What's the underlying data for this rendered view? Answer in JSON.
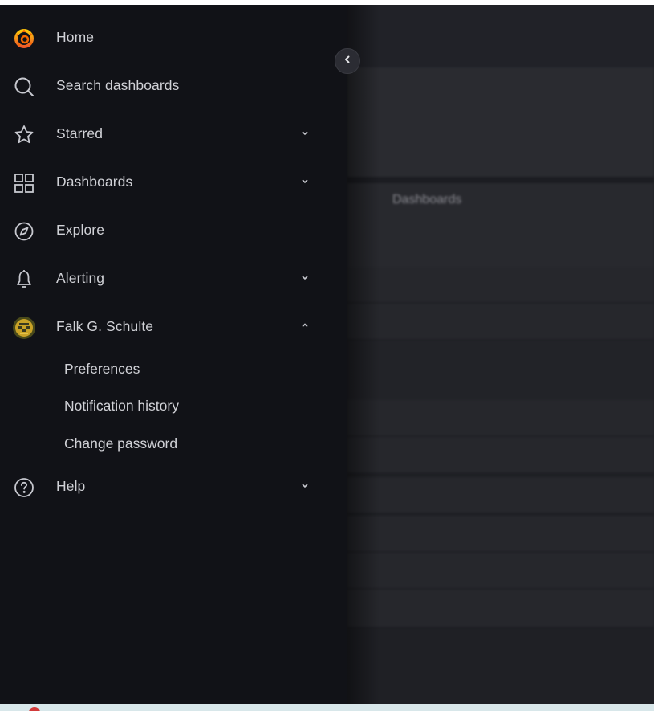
{
  "nav": {
    "home": "Home",
    "search": "Search dashboards",
    "starred": "Starred",
    "dashboards": "Dashboards",
    "explore": "Explore",
    "alerting": "Alerting",
    "user": "Falk G. Schulte",
    "help": "Help"
  },
  "user_menu": {
    "preferences": "Preferences",
    "notification_history": "Notification history",
    "change_password": "Change password"
  },
  "background": {
    "section_label": "Dashboards"
  },
  "colors": {
    "sidebar_bg": "#111217",
    "text": "#d0d1d6",
    "icon": "#c7c8cf",
    "logo_orange": "#f46800",
    "avatar_bg": "#c9a227"
  },
  "icons": {
    "home": "grafana-logo-icon",
    "search": "search-icon",
    "starred": "star-icon",
    "dashboards": "apps-grid-icon",
    "explore": "compass-icon",
    "alerting": "bell-icon",
    "user": "avatar",
    "help": "question-circle-icon",
    "collapse": "chevron-left-icon"
  }
}
